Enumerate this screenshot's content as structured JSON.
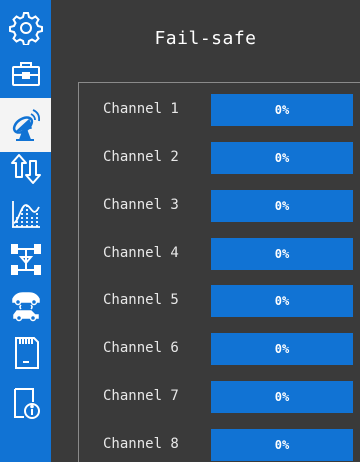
{
  "page": {
    "title": "Fail-safe"
  },
  "sidebar": {
    "items": [
      {
        "icon": "settings-gear-icon"
      },
      {
        "icon": "toolbox-icon"
      },
      {
        "icon": "satellite-dish-icon",
        "active": true
      },
      {
        "icon": "reverse-arrows-icon"
      },
      {
        "icon": "curve-chart-icon"
      },
      {
        "icon": "chassis-icon"
      },
      {
        "icon": "vehicle-mix-icon"
      },
      {
        "icon": "sd-card-icon"
      },
      {
        "icon": "info-document-icon"
      }
    ]
  },
  "channels": [
    {
      "label": "Channel 1",
      "value": "0%",
      "fill": 0
    },
    {
      "label": "Channel 2",
      "value": "0%",
      "fill": 0
    },
    {
      "label": "Channel 3",
      "value": "0%",
      "fill": 0
    },
    {
      "label": "Channel 4",
      "value": "0%",
      "fill": 0
    },
    {
      "label": "Channel 5",
      "value": "0%",
      "fill": 0
    },
    {
      "label": "Channel 6",
      "value": "0%",
      "fill": 0
    },
    {
      "label": "Channel 7",
      "value": "0%",
      "fill": 0
    },
    {
      "label": "Channel 8",
      "value": "0%",
      "fill": 0
    }
  ],
  "colors": {
    "accent": "#1173d4",
    "background": "#3a3a3a",
    "active_item": "#f4f4f4"
  }
}
